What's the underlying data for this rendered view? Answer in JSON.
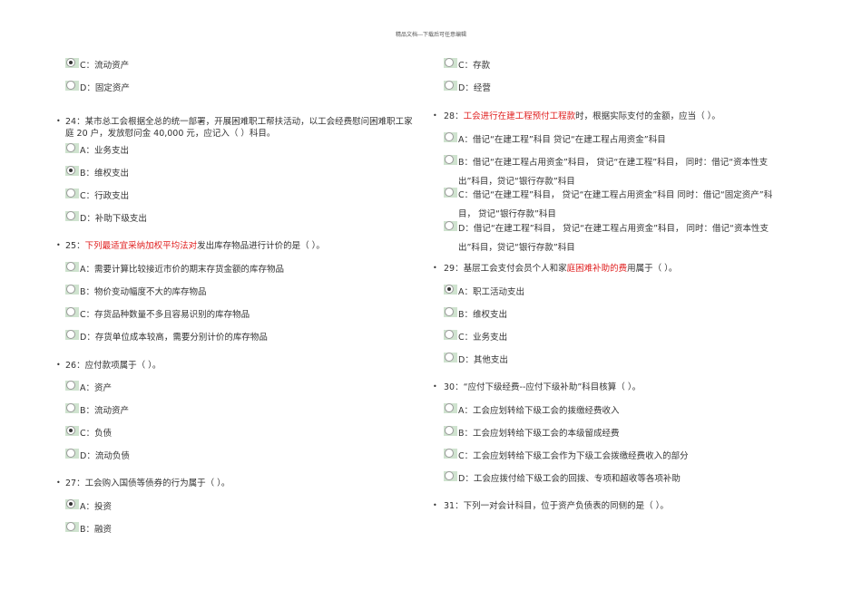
{
  "header": "精品文档---下载后可任意编辑",
  "left": [
    {
      "options": [
        {
          "label": "C：流动资产",
          "checked": true
        },
        {
          "label": "D：固定资产",
          "checked": false
        }
      ]
    },
    {
      "number": "24：",
      "parts": [
        {
          "t": "某市总工会根据全总的统一部署，开展困难职工帮扶活动，以工会经费慰问困难职工家庭 20 户，发放慰问金 40,000 元，应记入（ ）科目。",
          "red": false
        }
      ],
      "options": [
        {
          "label": "A：业务支出",
          "checked": false
        },
        {
          "label": "B：维权支出",
          "checked": true
        },
        {
          "label": "C：行政支出",
          "checked": false
        },
        {
          "label": "D：补助下级支出",
          "checked": false
        }
      ]
    },
    {
      "number": "25：",
      "parts": [
        {
          "t": "下列最适宜采纳加权平均法对",
          "red": true
        },
        {
          "t": "发出库存物品进行计价的是（ ）。",
          "red": false
        }
      ],
      "options": [
        {
          "label": "A：需要计算比较接近市价的期末存货金额的库存物品",
          "checked": false
        },
        {
          "label": "B：物价变动幅度不大的库存物品",
          "checked": false
        },
        {
          "label": "C：存货品种数量不多且容易识别的库存物品",
          "checked": false
        },
        {
          "label": "D：存货单位成本较高，需要分别计价的库存物品",
          "checked": false
        }
      ]
    },
    {
      "number": "26：",
      "parts": [
        {
          "t": "应付款项属于（ ）。",
          "red": false
        }
      ],
      "options": [
        {
          "label": "A：资产",
          "checked": false
        },
        {
          "label": "B：流动资产",
          "checked": false
        },
        {
          "label": "C：负债",
          "checked": true
        },
        {
          "label": "D：流动负债",
          "checked": false
        }
      ]
    },
    {
      "number": "27：",
      "parts": [
        {
          "t": "工会购入国债等债券的行为属于（ ）。",
          "red": false
        }
      ],
      "options": [
        {
          "label": "A：投资",
          "checked": true
        },
        {
          "label": "B：融资",
          "checked": false
        }
      ]
    }
  ],
  "right": [
    {
      "options": [
        {
          "label": "C：存款",
          "checked": false
        },
        {
          "label": "D：经营",
          "checked": false
        }
      ]
    },
    {
      "number": "28：",
      "parts": [
        {
          "t": "工会进行在建工程预付工程款",
          "red": true
        },
        {
          "t": "时，根据实际支付的金额，应当（ ）。",
          "red": false
        }
      ],
      "options": [
        {
          "label": "A：借记“在建工程”科目 贷记“在建工程占用资金”科目",
          "checked": false
        },
        {
          "label": "B：借记“在建工程占用资金”科目， 贷记“在建工程”科目， 同时：借记“资本性支出”科目，贷记“银行存款”科目",
          "checked": false
        },
        {
          "label": "C：借记“在建工程”科目， 贷记“在建工程占用资金”科目 同时：借记“固定资产”科目， 贷记“银行存款”科目",
          "checked": false
        },
        {
          "label": "D：借记“在建工程”科目， 贷记“在建工程占用资金”科目， 同时：借记“资本性支出”科目，贷记“银行存款”科目",
          "checked": false
        }
      ]
    },
    {
      "number": "29：",
      "parts": [
        {
          "t": "基层工会支付会员个人和家",
          "red": false
        },
        {
          "t": "庭困难补助的费",
          "red": true
        },
        {
          "t": "用属于（ ）。",
          "red": false
        }
      ],
      "options": [
        {
          "label": "A：职工活动支出",
          "checked": true
        },
        {
          "label": "B：维权支出",
          "checked": false
        },
        {
          "label": "C：业务支出",
          "checked": false
        },
        {
          "label": "D：其他支出",
          "checked": false
        }
      ]
    },
    {
      "number": "30：",
      "parts": [
        {
          "t": "“应付下级经费--应付下级补助”科目核算（ ）。",
          "red": false
        }
      ],
      "options": [
        {
          "label": "A：工会应划转给下级工会的拨缴经费收入",
          "checked": false
        },
        {
          "label": "B：工会应划转给下级工会的本级留成经费",
          "checked": false
        },
        {
          "label": "C：工会应划转给下级工会作为下级工会拨缴经费收入的部分",
          "checked": false
        },
        {
          "label": "D：工会应拨付给下级工会的回拨、专项和超收等各项补助",
          "checked": false
        }
      ]
    },
    {
      "number": "31：",
      "parts": [
        {
          "t": "下列一对会计科目，位于资产负债表的同侧的是（ ）。",
          "red": false
        }
      ],
      "options": []
    }
  ]
}
